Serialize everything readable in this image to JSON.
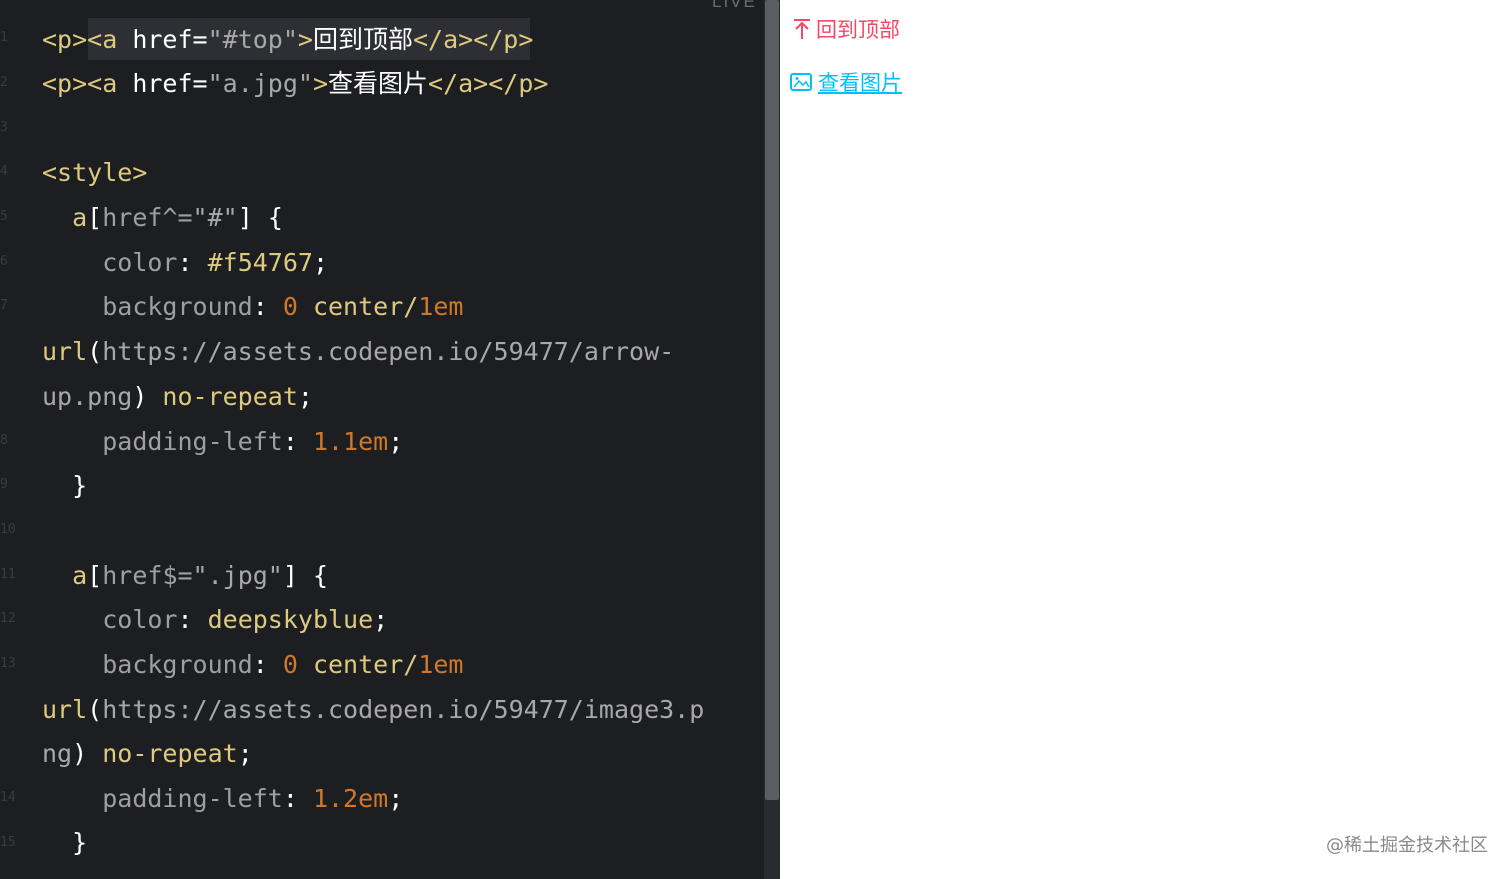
{
  "editor": {
    "live_label": "LIVE",
    "line_numbers": [
      "1",
      "2",
      "3",
      "4",
      "5",
      "6",
      "7",
      "",
      "",
      "8",
      "9",
      "10",
      "11",
      "12",
      "13",
      "",
      "",
      "14",
      "15"
    ],
    "code": {
      "l1": {
        "open_p": "<p>",
        "open_a": "<a ",
        "attr": "href",
        "eq": "=",
        "str": "\"#top\"",
        "close": ">",
        "text": "回到顶部",
        "end": "</a></p>"
      },
      "l2": {
        "open_p": "<p>",
        "open_a": "<a ",
        "attr": "href",
        "eq": "=",
        "str": "\"a.jpg\"",
        "close": ">",
        "text": "查看图片",
        "end": "</a></p>"
      },
      "l4": {
        "tag": "<style>"
      },
      "l5": {
        "sel": "a",
        "bracket_open": "[",
        "attr": "href^=",
        "str": "\"#\"",
        "bracket_close": "]",
        "brace": " {"
      },
      "l6": {
        "prop": "color",
        "colon": ": ",
        "val": "#f54767",
        "semi": ";"
      },
      "l7": {
        "prop": "background",
        "colon": ": ",
        "num": "0",
        "val": " center/",
        "num2": "1em"
      },
      "l7b": {
        "fn": "url",
        "paren": "(",
        "url": "https://assets.codepen.io/59477/arrow-"
      },
      "l7c": {
        "url": "up.png",
        "paren": ") ",
        "val": "no-repeat",
        "semi": ";"
      },
      "l8": {
        "prop": "padding-left",
        "colon": ": ",
        "num": "1.1em",
        "semi": ";"
      },
      "l9": {
        "brace": "}"
      },
      "l11": {
        "sel": "a",
        "bracket_open": "[",
        "attr": "href$=",
        "str": "\".jpg\"",
        "bracket_close": "]",
        "brace": " {"
      },
      "l12": {
        "prop": "color",
        "colon": ": ",
        "val": "deepskyblue",
        "semi": ";"
      },
      "l13": {
        "prop": "background",
        "colon": ": ",
        "num": "0",
        "val": " center/",
        "num2": "1em"
      },
      "l13b": {
        "fn": "url",
        "paren": "(",
        "url": "https://assets.codepen.io/59477/image3.p"
      },
      "l13c": {
        "url": "ng",
        "paren": ") ",
        "val": "no-repeat",
        "semi": ";"
      },
      "l14": {
        "prop": "padding-left",
        "colon": ": ",
        "num": "1.2em",
        "semi": ";"
      },
      "l15": {
        "brace": "}"
      }
    }
  },
  "preview": {
    "link_top_text": "回到顶部",
    "link_jpg_text": "查看图片",
    "colors": {
      "top": "#f54767",
      "jpg": "#00bfff"
    }
  },
  "watermark": "@稀土掘金技术社区"
}
